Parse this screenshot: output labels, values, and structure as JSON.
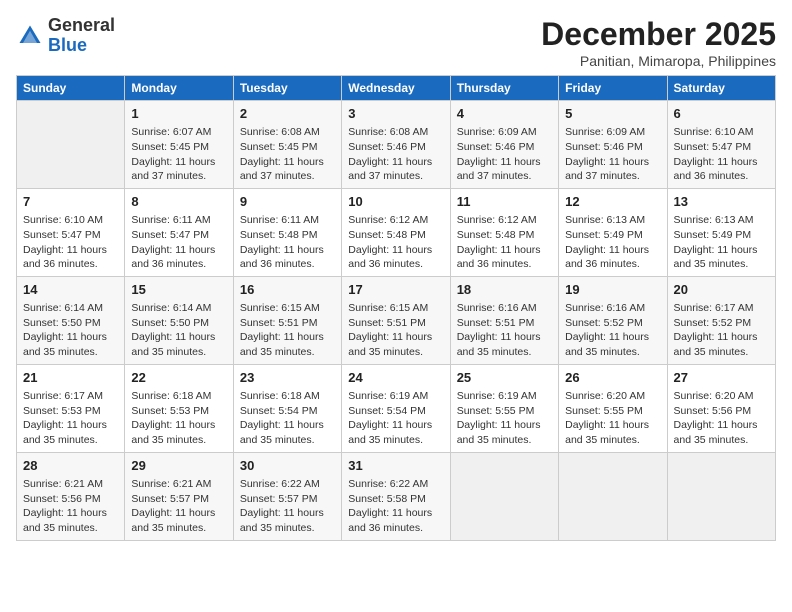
{
  "header": {
    "logo_general": "General",
    "logo_blue": "Blue",
    "month_title": "December 2025",
    "subtitle": "Panitian, Mimaropa, Philippines"
  },
  "days_of_week": [
    "Sunday",
    "Monday",
    "Tuesday",
    "Wednesday",
    "Thursday",
    "Friday",
    "Saturday"
  ],
  "weeks": [
    [
      {
        "day": "",
        "info": ""
      },
      {
        "day": "1",
        "info": "Sunrise: 6:07 AM\nSunset: 5:45 PM\nDaylight: 11 hours\nand 37 minutes."
      },
      {
        "day": "2",
        "info": "Sunrise: 6:08 AM\nSunset: 5:45 PM\nDaylight: 11 hours\nand 37 minutes."
      },
      {
        "day": "3",
        "info": "Sunrise: 6:08 AM\nSunset: 5:46 PM\nDaylight: 11 hours\nand 37 minutes."
      },
      {
        "day": "4",
        "info": "Sunrise: 6:09 AM\nSunset: 5:46 PM\nDaylight: 11 hours\nand 37 minutes."
      },
      {
        "day": "5",
        "info": "Sunrise: 6:09 AM\nSunset: 5:46 PM\nDaylight: 11 hours\nand 37 minutes."
      },
      {
        "day": "6",
        "info": "Sunrise: 6:10 AM\nSunset: 5:47 PM\nDaylight: 11 hours\nand 36 minutes."
      }
    ],
    [
      {
        "day": "7",
        "info": "Sunrise: 6:10 AM\nSunset: 5:47 PM\nDaylight: 11 hours\nand 36 minutes."
      },
      {
        "day": "8",
        "info": "Sunrise: 6:11 AM\nSunset: 5:47 PM\nDaylight: 11 hours\nand 36 minutes."
      },
      {
        "day": "9",
        "info": "Sunrise: 6:11 AM\nSunset: 5:48 PM\nDaylight: 11 hours\nand 36 minutes."
      },
      {
        "day": "10",
        "info": "Sunrise: 6:12 AM\nSunset: 5:48 PM\nDaylight: 11 hours\nand 36 minutes."
      },
      {
        "day": "11",
        "info": "Sunrise: 6:12 AM\nSunset: 5:48 PM\nDaylight: 11 hours\nand 36 minutes."
      },
      {
        "day": "12",
        "info": "Sunrise: 6:13 AM\nSunset: 5:49 PM\nDaylight: 11 hours\nand 36 minutes."
      },
      {
        "day": "13",
        "info": "Sunrise: 6:13 AM\nSunset: 5:49 PM\nDaylight: 11 hours\nand 35 minutes."
      }
    ],
    [
      {
        "day": "14",
        "info": "Sunrise: 6:14 AM\nSunset: 5:50 PM\nDaylight: 11 hours\nand 35 minutes."
      },
      {
        "day": "15",
        "info": "Sunrise: 6:14 AM\nSunset: 5:50 PM\nDaylight: 11 hours\nand 35 minutes."
      },
      {
        "day": "16",
        "info": "Sunrise: 6:15 AM\nSunset: 5:51 PM\nDaylight: 11 hours\nand 35 minutes."
      },
      {
        "day": "17",
        "info": "Sunrise: 6:15 AM\nSunset: 5:51 PM\nDaylight: 11 hours\nand 35 minutes."
      },
      {
        "day": "18",
        "info": "Sunrise: 6:16 AM\nSunset: 5:51 PM\nDaylight: 11 hours\nand 35 minutes."
      },
      {
        "day": "19",
        "info": "Sunrise: 6:16 AM\nSunset: 5:52 PM\nDaylight: 11 hours\nand 35 minutes."
      },
      {
        "day": "20",
        "info": "Sunrise: 6:17 AM\nSunset: 5:52 PM\nDaylight: 11 hours\nand 35 minutes."
      }
    ],
    [
      {
        "day": "21",
        "info": "Sunrise: 6:17 AM\nSunset: 5:53 PM\nDaylight: 11 hours\nand 35 minutes."
      },
      {
        "day": "22",
        "info": "Sunrise: 6:18 AM\nSunset: 5:53 PM\nDaylight: 11 hours\nand 35 minutes."
      },
      {
        "day": "23",
        "info": "Sunrise: 6:18 AM\nSunset: 5:54 PM\nDaylight: 11 hours\nand 35 minutes."
      },
      {
        "day": "24",
        "info": "Sunrise: 6:19 AM\nSunset: 5:54 PM\nDaylight: 11 hours\nand 35 minutes."
      },
      {
        "day": "25",
        "info": "Sunrise: 6:19 AM\nSunset: 5:55 PM\nDaylight: 11 hours\nand 35 minutes."
      },
      {
        "day": "26",
        "info": "Sunrise: 6:20 AM\nSunset: 5:55 PM\nDaylight: 11 hours\nand 35 minutes."
      },
      {
        "day": "27",
        "info": "Sunrise: 6:20 AM\nSunset: 5:56 PM\nDaylight: 11 hours\nand 35 minutes."
      }
    ],
    [
      {
        "day": "28",
        "info": "Sunrise: 6:21 AM\nSunset: 5:56 PM\nDaylight: 11 hours\nand 35 minutes."
      },
      {
        "day": "29",
        "info": "Sunrise: 6:21 AM\nSunset: 5:57 PM\nDaylight: 11 hours\nand 35 minutes."
      },
      {
        "day": "30",
        "info": "Sunrise: 6:22 AM\nSunset: 5:57 PM\nDaylight: 11 hours\nand 35 minutes."
      },
      {
        "day": "31",
        "info": "Sunrise: 6:22 AM\nSunset: 5:58 PM\nDaylight: 11 hours\nand 36 minutes."
      },
      {
        "day": "",
        "info": ""
      },
      {
        "day": "",
        "info": ""
      },
      {
        "day": "",
        "info": ""
      }
    ]
  ]
}
